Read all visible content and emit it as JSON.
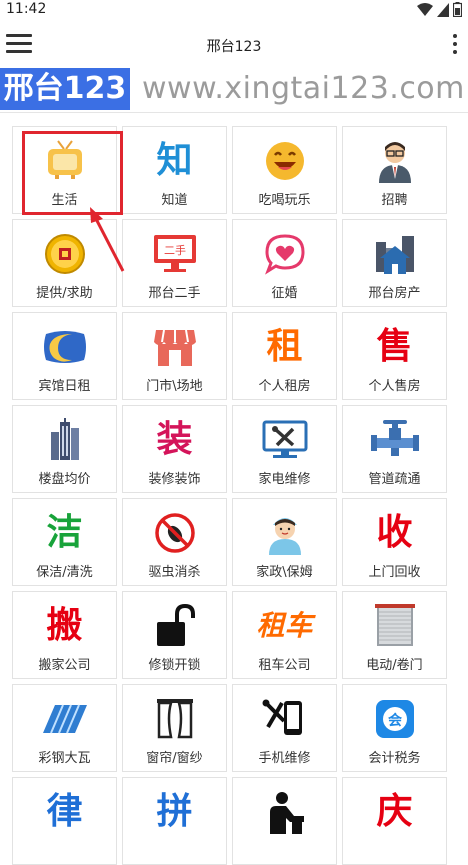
{
  "status": {
    "time": "11:42"
  },
  "appbar": {
    "title": "邢台123"
  },
  "banner": {
    "logo": "邢台123",
    "domain": "www.xingtai123.com"
  },
  "tiles": [
    {
      "label": "生活",
      "icon": "tv-icon"
    },
    {
      "label": "知道",
      "icon": "char-zhi-icon",
      "char": "知",
      "color": "#1f8fd6"
    },
    {
      "label": "吃喝玩乐",
      "icon": "laughing-face-icon"
    },
    {
      "label": "招聘",
      "icon": "businessman-icon"
    },
    {
      "label": "提供/求助",
      "icon": "gold-coin-icon"
    },
    {
      "label": "邢台二手",
      "icon": "secondhand-monitor-icon",
      "badge": "二手"
    },
    {
      "label": "征婚",
      "icon": "heart-chat-icon"
    },
    {
      "label": "邢台房产",
      "icon": "house-buildings-icon"
    },
    {
      "label": "宾馆日租",
      "icon": "moon-pillow-icon"
    },
    {
      "label": "门市\\场地",
      "icon": "storefront-icon"
    },
    {
      "label": "个人租房",
      "icon": "char-zu-icon",
      "char": "租",
      "color": "#ff6a00"
    },
    {
      "label": "个人售房",
      "icon": "char-shou-icon",
      "char": "售",
      "color": "#e60012"
    },
    {
      "label": "楼盘均价",
      "icon": "skyscraper-icon"
    },
    {
      "label": "装修装饰",
      "icon": "char-zhuang-icon",
      "char": "装",
      "color": "#d4145a"
    },
    {
      "label": "家电维修",
      "icon": "tools-monitor-icon"
    },
    {
      "label": "管道疏通",
      "icon": "pipe-valve-icon"
    },
    {
      "label": "保洁/清洗",
      "icon": "char-jie-icon",
      "char": "洁",
      "color": "#18a33a"
    },
    {
      "label": "驱虫消杀",
      "icon": "no-bugs-icon"
    },
    {
      "label": "家政\\保姆",
      "icon": "nanny-icon"
    },
    {
      "label": "上门回收",
      "icon": "char-shou2-icon",
      "char": "收",
      "color": "#e60012"
    },
    {
      "label": "搬家公司",
      "icon": "char-ban-icon",
      "char": "搬",
      "color": "#e60012"
    },
    {
      "label": "修锁开锁",
      "icon": "open-padlock-icon"
    },
    {
      "label": "租车公司",
      "icon": "char-zuche-icon",
      "char": "租车",
      "color": "#ff6a00"
    },
    {
      "label": "电动/卷门",
      "icon": "rolling-door-icon"
    },
    {
      "label": "彩钢大瓦",
      "icon": "steel-roof-icon"
    },
    {
      "label": "窗帘/窗纱",
      "icon": "curtain-icon"
    },
    {
      "label": "手机维修",
      "icon": "phone-repair-icon"
    },
    {
      "label": "会计税务",
      "icon": "accounting-icon"
    },
    {
      "label": "",
      "icon": "char-lv-icon",
      "char": "律",
      "color": "#1f6fd6"
    },
    {
      "label": "",
      "icon": "char-pin-icon",
      "char": "拼",
      "color": "#1f6fd6"
    },
    {
      "label": "",
      "icon": "driver-icon"
    },
    {
      "label": "",
      "icon": "char-qing-icon",
      "char": "庆",
      "color": "#e60012"
    }
  ]
}
